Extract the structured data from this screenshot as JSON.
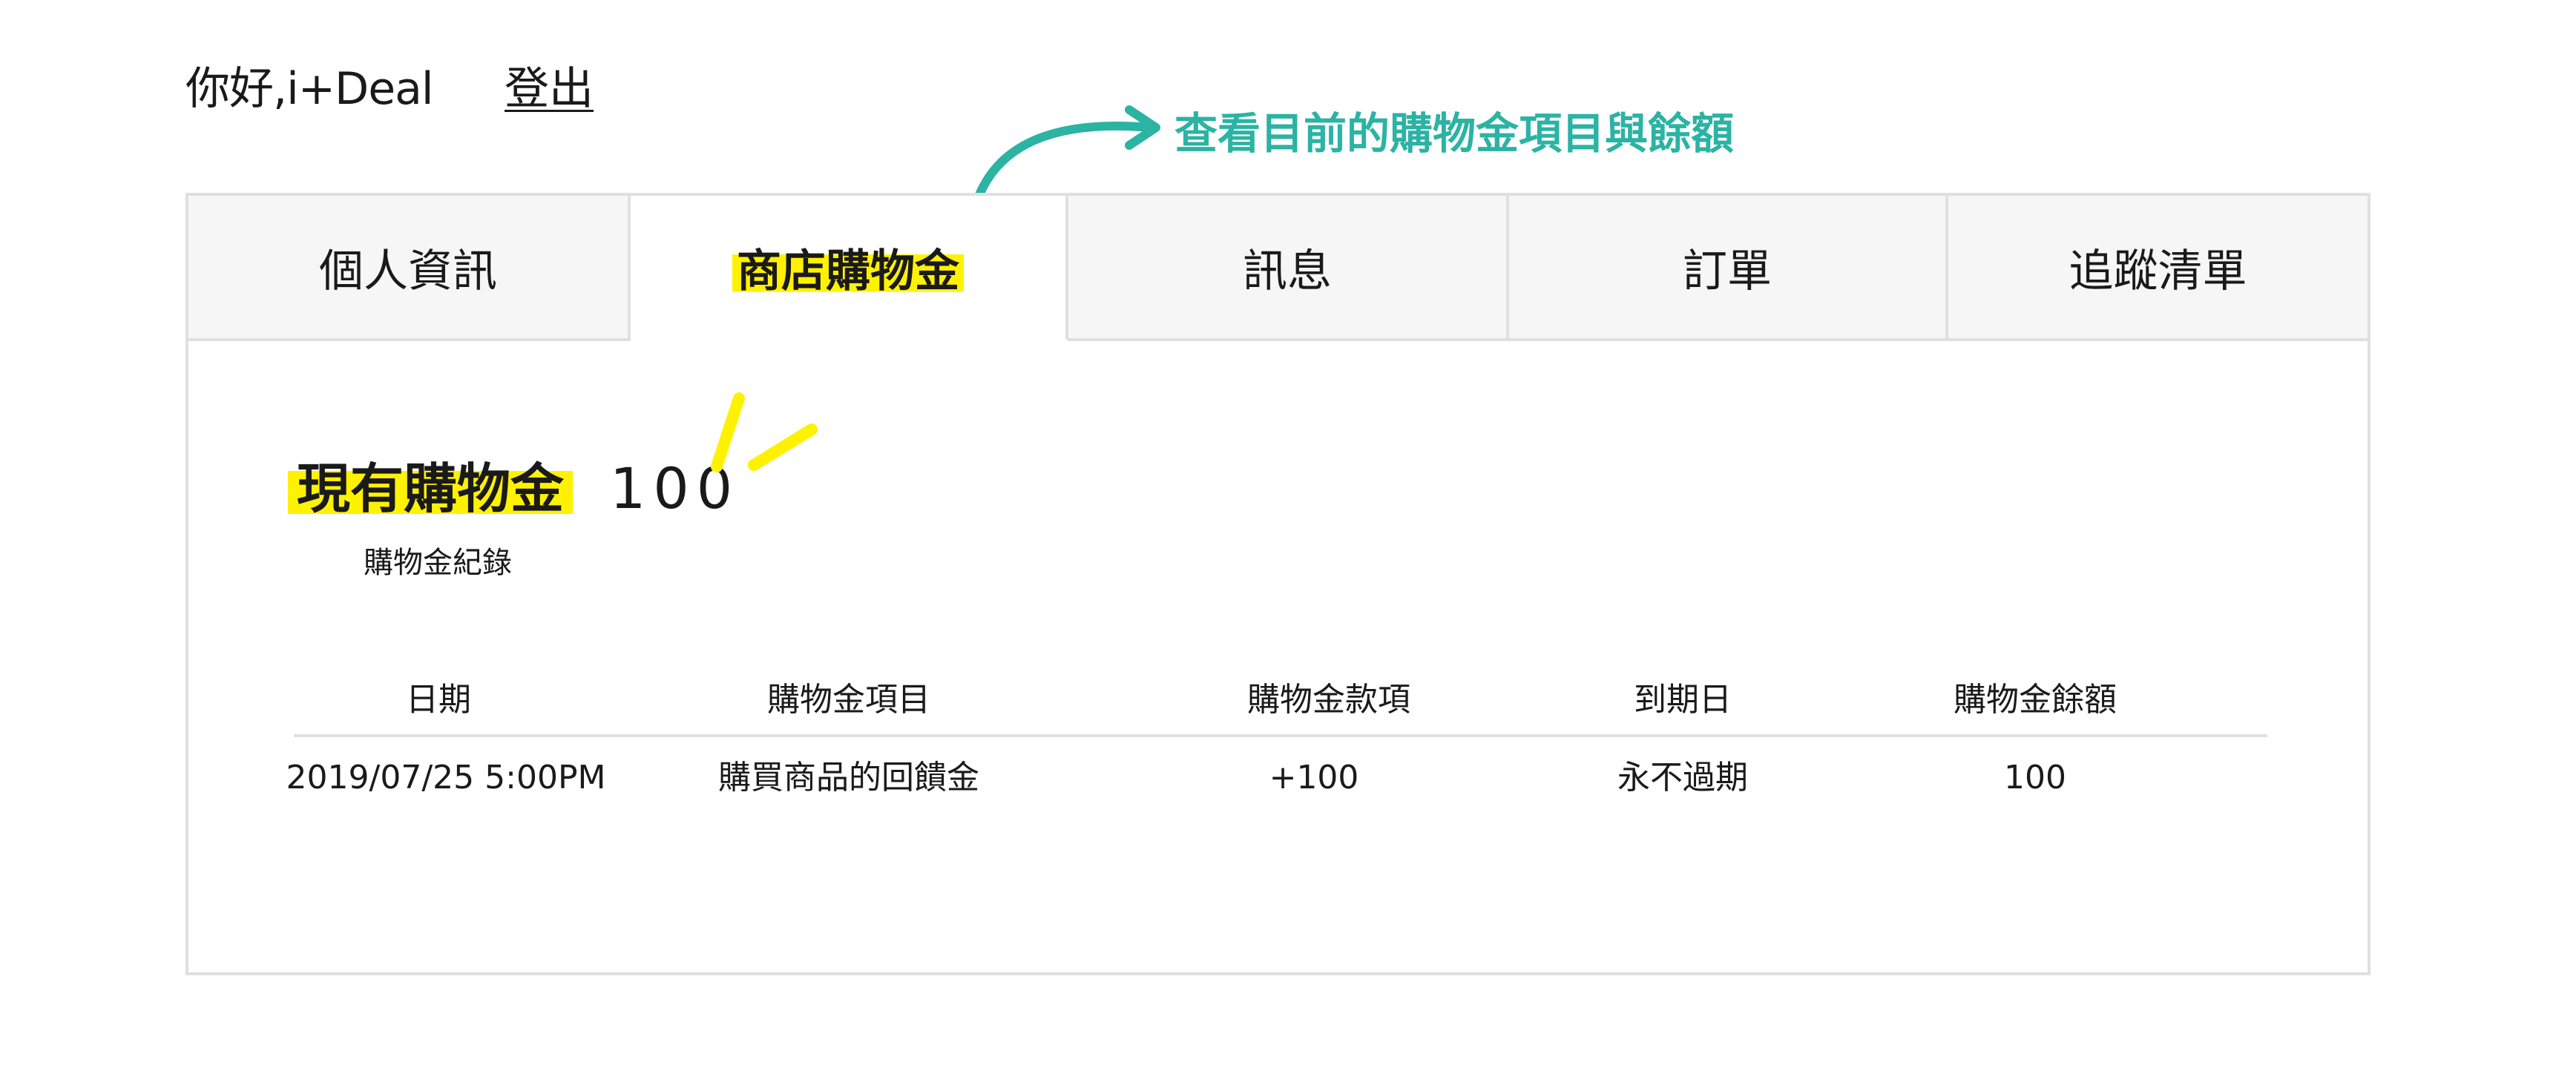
{
  "header": {
    "greeting": "你好,i+Deal",
    "logout_label": "登出"
  },
  "annotation": {
    "text": "查看目前的購物金項目與餘額",
    "color": "#2bb3a3"
  },
  "tabs": [
    {
      "label": "個人資訊",
      "active": false
    },
    {
      "label": "商店購物金",
      "active": true
    },
    {
      "label": "訊息",
      "active": false
    },
    {
      "label": "訂單",
      "active": false
    },
    {
      "label": "追蹤清單",
      "active": false
    }
  ],
  "balance": {
    "label": "現有購物金",
    "value": "100"
  },
  "record_link": "購物金紀錄",
  "table": {
    "columns": [
      "日期",
      "購物金項目",
      "購物金款項",
      "到期日",
      "購物金餘額"
    ],
    "rows": [
      [
        "2019/07/25 5:00PM",
        "購買商品的回饋金",
        "+100",
        "永不過期",
        "100"
      ]
    ]
  },
  "colors": {
    "highlight": "#fff200",
    "border": "#e0e0e0",
    "tab_bg": "#f6f6f6"
  }
}
